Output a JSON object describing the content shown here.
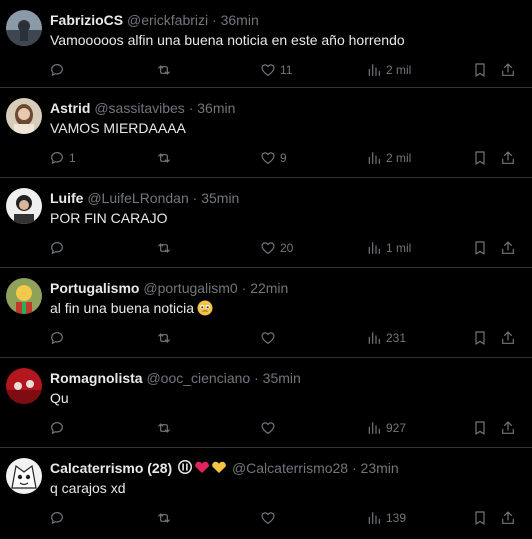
{
  "tweets": [
    {
      "name": "FabrizioCS",
      "handle": "@erickfabrizi",
      "time": "36min",
      "text": "Vamooooos alfin una buena noticia en este año horrendo",
      "replies": "",
      "retweets": "",
      "likes": "11",
      "views": "2 mil",
      "avatar_color": "#5d6b78"
    },
    {
      "name": "Astrid",
      "handle": "@sassitavibes",
      "time": "36min",
      "text": "VAMOS MIERDAAAA",
      "replies": "1",
      "retweets": "",
      "likes": "9",
      "views": "2 mil",
      "avatar_color": "#b8a58a"
    },
    {
      "name": "Luife",
      "handle": "@LuifeLRondan",
      "time": "35min",
      "text": "POR FIN CARAJO",
      "replies": "",
      "retweets": "",
      "likes": "20",
      "views": "1 mil",
      "avatar_color": "#d9d9d9"
    },
    {
      "name": "Portugalismo",
      "handle": "@portugalism0",
      "time": "22min",
      "text": "al fin una buena noticia",
      "emoji": "🥹",
      "replies": "",
      "retweets": "",
      "likes": "",
      "views": "231",
      "avatar_color": "#6d7f3c"
    },
    {
      "name": "Romagnolista",
      "handle": "@ooc_cienciano",
      "time": "35min",
      "text": "Qu",
      "replies": "",
      "retweets": "",
      "likes": "",
      "views": "927",
      "avatar_color": "#c8242b"
    },
    {
      "name": "Calcaterrismo (28)",
      "handle": "@Calcaterrismo28",
      "time": "23min",
      "text": "q carajos xd",
      "replies": "",
      "retweets": "",
      "likes": "",
      "views": "139",
      "avatar_color": "#e9e9e9"
    }
  ],
  "separator": "·",
  "colors": {
    "background": "#000000",
    "text": "#e7e9ea",
    "muted": "#71767b",
    "divider": "#2f3336"
  }
}
